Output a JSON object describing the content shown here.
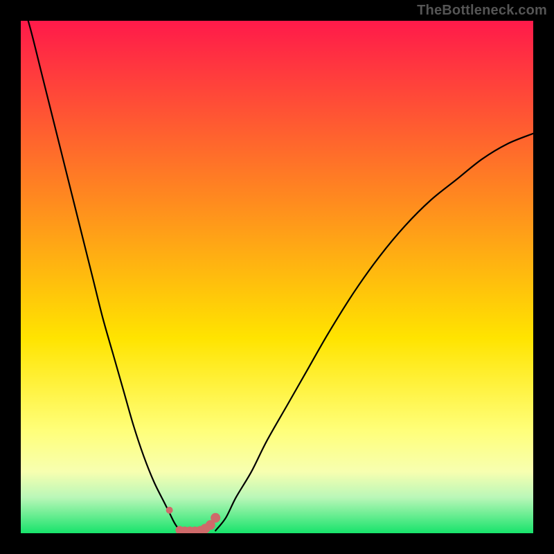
{
  "attribution": "TheBottleneck.com",
  "colors": {
    "bg_black": "#000000",
    "curve": "#000000",
    "marker_fill": "#cf6a6a",
    "grad_top": "#ff1a4a",
    "grad_mid1": "#ff8a1f",
    "grad_mid2": "#ffe400",
    "grad_lowband_top": "#ffff7a",
    "grad_lowband_bottom": "#f7ffb0",
    "grad_green_top": "#baf7b8",
    "grad_green_bottom": "#17e36b"
  },
  "chart_data": {
    "type": "line",
    "title": "",
    "xlabel": "",
    "ylabel": "",
    "xlim": [
      0,
      100
    ],
    "ylim": [
      0,
      100
    ],
    "series": [
      {
        "name": "left-curve",
        "x": [
          0,
          2,
          4,
          6,
          8,
          10,
          12,
          14,
          16,
          18,
          20,
          22,
          24,
          26,
          28,
          29,
          30,
          31
        ],
        "y": [
          105,
          98,
          90,
          82,
          74,
          66,
          58,
          50,
          42,
          35,
          28,
          21,
          15,
          10,
          6,
          4,
          2,
          0.5
        ]
      },
      {
        "name": "right-curve",
        "x": [
          38,
          40,
          42,
          45,
          48,
          52,
          56,
          60,
          65,
          70,
          75,
          80,
          85,
          90,
          95,
          100
        ],
        "y": [
          0.5,
          3,
          7,
          12,
          18,
          25,
          32,
          39,
          47,
          54,
          60,
          65,
          69,
          73,
          76,
          78
        ]
      }
    ],
    "floor_markers": {
      "name": "floor-points",
      "x": [
        29,
        31,
        32,
        33,
        34,
        35,
        36,
        37,
        38
      ],
      "y": [
        4.5,
        0.6,
        0.5,
        0.5,
        0.5,
        0.6,
        0.9,
        1.6,
        3.0
      ],
      "r": [
        5,
        6,
        6,
        6,
        6,
        6,
        7,
        7,
        7
      ]
    },
    "gradient_stops_pct": [
      0,
      35,
      62,
      80,
      88,
      93,
      100
    ]
  }
}
